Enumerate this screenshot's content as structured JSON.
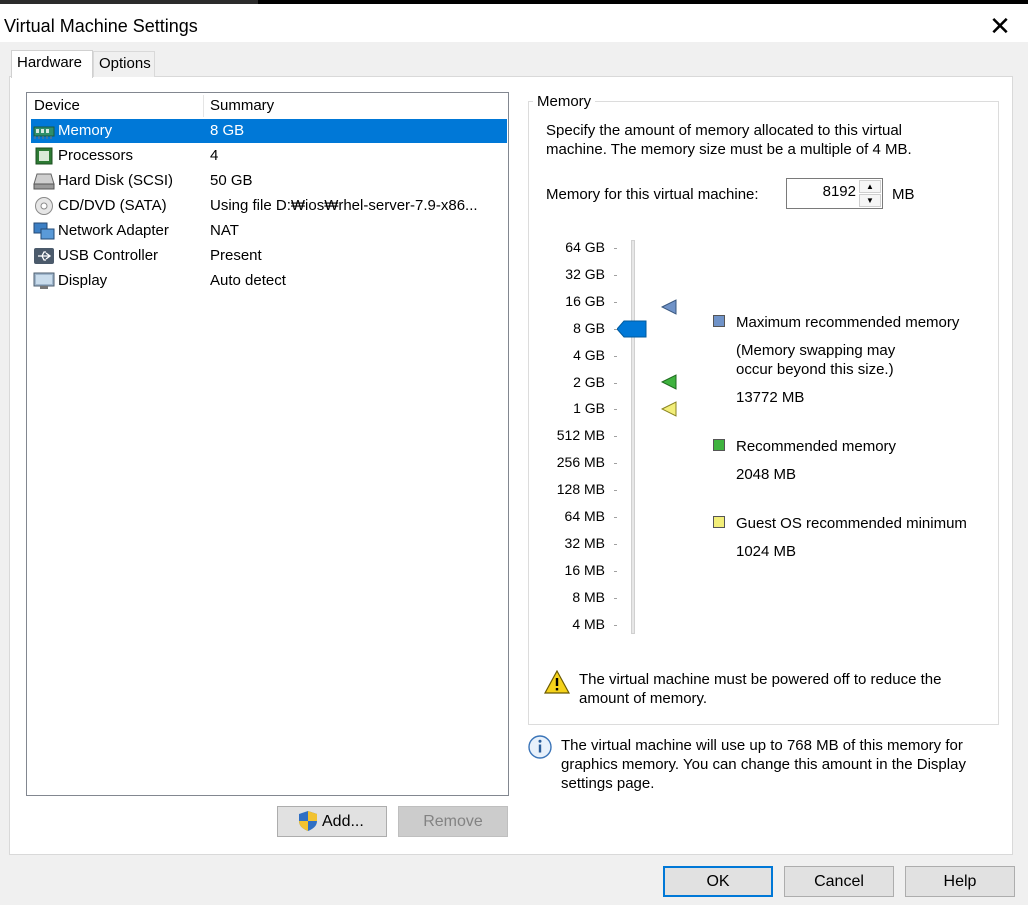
{
  "window": {
    "title": "Virtual Machine Settings"
  },
  "tabs": [
    {
      "label": "Hardware"
    },
    {
      "label": "Options"
    }
  ],
  "device_list": {
    "headers": {
      "device": "Device",
      "summary": "Summary"
    },
    "rows": [
      {
        "device": "Memory",
        "summary": "8 GB",
        "icon": "memory-icon"
      },
      {
        "device": "Processors",
        "summary": "4",
        "icon": "processor-icon"
      },
      {
        "device": "Hard Disk (SCSI)",
        "summary": "50 GB",
        "icon": "hard-disk-icon"
      },
      {
        "device": "CD/DVD (SATA)",
        "summary": "Using file D:₩ios₩rhel-server-7.9-x86...",
        "icon": "cd-dvd-icon"
      },
      {
        "device": "Network Adapter",
        "summary": "NAT",
        "icon": "network-adapter-icon"
      },
      {
        "device": "USB Controller",
        "summary": "Present",
        "icon": "usb-icon"
      },
      {
        "device": "Display",
        "summary": "Auto detect",
        "icon": "display-icon"
      }
    ],
    "selected": "Memory"
  },
  "buttons": {
    "add": "Add...",
    "remove": "Remove",
    "ok": "OK",
    "cancel": "Cancel",
    "help": "Help"
  },
  "memory": {
    "group_label": "Memory",
    "description_line1": "Specify the amount of memory allocated to this virtual",
    "description_line2": "machine. The memory size must be a multiple of 4 MB.",
    "field_label": "Memory for this virtual machine:",
    "value": "8192",
    "unit": "MB",
    "scale_labels": [
      "64 GB",
      "32 GB",
      "16 GB",
      "8 GB",
      "4 GB",
      "2 GB",
      "1 GB",
      "512 MB",
      "256 MB",
      "128 MB",
      "64 MB",
      "32 MB",
      "16 MB",
      "8 MB",
      "4 MB"
    ],
    "slider_current": "8 GB",
    "legend": {
      "max_title": "Maximum recommended memory",
      "max_note_line1": "(Memory swapping may",
      "max_note_line2": "occur beyond this size.)",
      "max_value": "13772 MB",
      "rec_title": "Recommended memory",
      "rec_value": "2048 MB",
      "min_title": "Guest OS recommended minimum",
      "min_value": "1024 MB"
    },
    "warning_line1": "The virtual machine must be powered off to reduce the",
    "warning_line2": "amount of memory.",
    "info_line1": "The virtual machine will use up to 768 MB of this memory for",
    "info_line2": "graphics memory. You can change this amount in the Display",
    "info_line3": "settings page."
  },
  "colors": {
    "selection": "#0078d7",
    "max_marker": "#7093c8",
    "rec_marker": "#3fb33f",
    "min_marker": "#f2ee79"
  }
}
